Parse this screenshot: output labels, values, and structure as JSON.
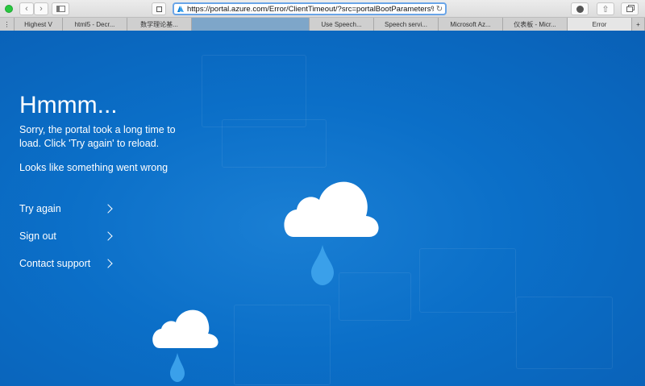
{
  "browser": {
    "url": "https://portal.azure.com/Error/ClientTimeout/?src=portalBootParameters%20is%",
    "tabs": [
      {
        "label": "Highest V",
        "width": 60
      },
      {
        "label": "html5 - Decr...",
        "width": 80
      },
      {
        "label": "数学理论基...",
        "width": 80
      },
      {
        "label": "",
        "width": 146
      },
      {
        "label": "Use Speech...",
        "width": 80
      },
      {
        "label": "Speech servi...",
        "width": 80
      },
      {
        "label": "Microsoft Az...",
        "width": 80
      },
      {
        "label": "仪表板 - Micr...",
        "width": 80
      },
      {
        "label": "Error",
        "width": 80
      }
    ]
  },
  "error": {
    "title": "Hmmm...",
    "message": "Sorry, the portal took a long time to load. Click 'Try again' to reload.",
    "sub_message": "Looks like something went wrong"
  },
  "actions": {
    "try_again": "Try again",
    "sign_out": "Sign out",
    "contact_support": "Contact support"
  },
  "colors": {
    "background": "#0b6fc8",
    "raindrop": "#3aa0ea",
    "cloud": "#ffffff"
  }
}
